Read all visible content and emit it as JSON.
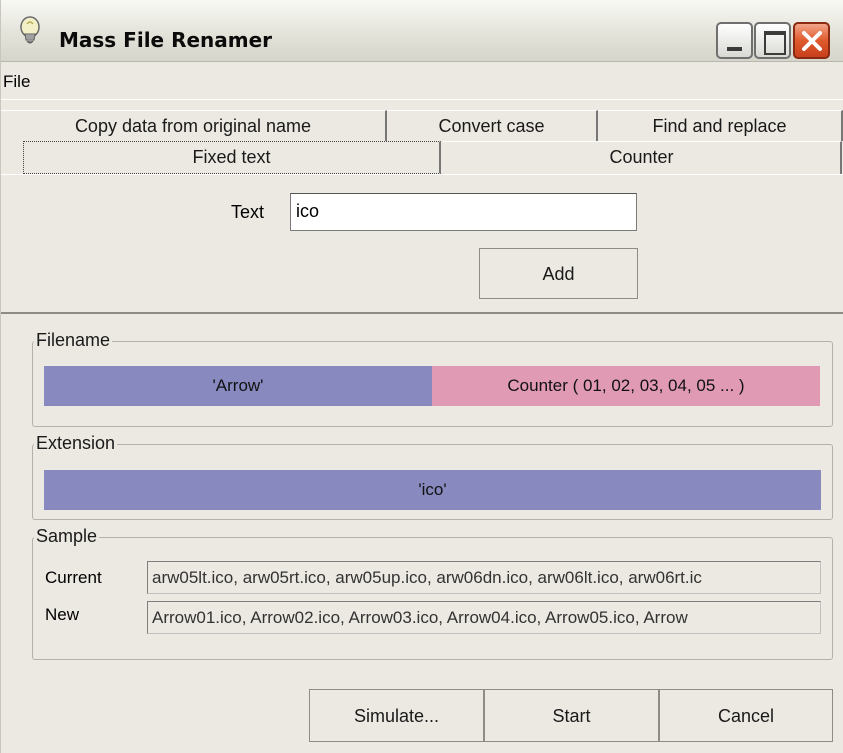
{
  "window": {
    "title": "Mass File Renamer"
  },
  "menu": {
    "file": "File"
  },
  "tabs": {
    "row1": [
      "Copy data from original name",
      "Convert case",
      "Find and replace"
    ],
    "row2": [
      "Fixed text",
      "Counter"
    ]
  },
  "fixed_text": {
    "text_label": "Text",
    "text_value": "ico",
    "add_label": "Add"
  },
  "filename": {
    "legend": "Filename",
    "segments": [
      "'Arrow'",
      "Counter ( 01, 02, 03, 04, 05 ... )"
    ]
  },
  "extension": {
    "legend": "Extension",
    "segment": "'ico'"
  },
  "sample": {
    "legend": "Sample",
    "current_label": "Current",
    "current_value": "arw05lt.ico, arw05rt.ico, arw05up.ico, arw06dn.ico, arw06lt.ico, arw06rt.ic",
    "new_label": "New",
    "new_value": "Arrow01.ico, Arrow02.ico, Arrow03.ico, Arrow04.ico, Arrow05.ico, Arrow"
  },
  "actions": {
    "simulate": "Simulate...",
    "start": "Start",
    "cancel": "Cancel"
  },
  "colors": {
    "fixed_segment": "#8789bf",
    "counter_segment": "#e09ab4",
    "window_bg": "#ebe9e1"
  },
  "icons": {
    "app": "lightbulb-icon",
    "minimize": "minimize-icon",
    "maximize": "maximize-icon",
    "close": "close-icon"
  }
}
